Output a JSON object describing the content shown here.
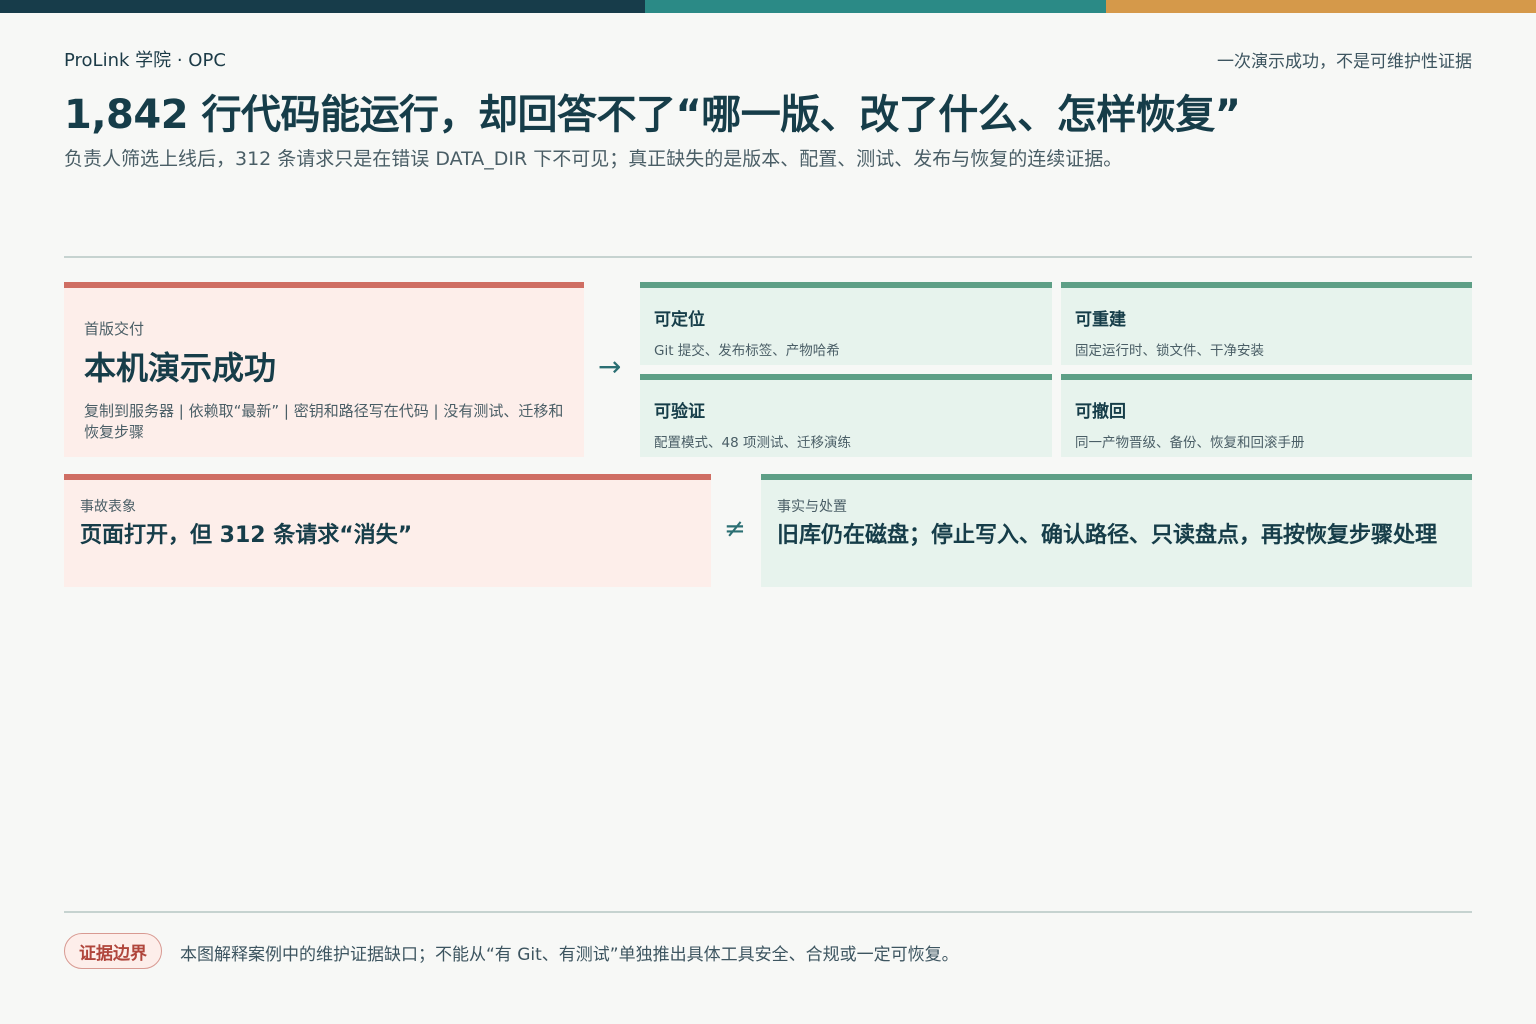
{
  "colors": {
    "bar_dark": "#173c4a",
    "bar_teal": "#2b8a86",
    "bar_orange": "#d5994a",
    "risk_red": "#cf6e63",
    "safe_green": "#5e9f86"
  },
  "header": {
    "brand": "ProLink 学院 · OPC",
    "tagline": "一次演示成功，不是可维护性证据",
    "title": "1,842 行代码能运行，却回答不了“哪一版、改了什么、怎样恢复”",
    "subtitle": "负责人筛选上线后，312 条请求只是在错误 DATA_DIR 下不可见；真正缺失的是版本、配置、测试、发布与恢复的连续证据。"
  },
  "hero": {
    "kicker": "首版交付",
    "head": "本机演示成功",
    "desc": "复制到服务器 | 依赖取“最新” | 密钥和路径写在代码 | 没有测试、迁移和恢复步骤"
  },
  "arrow_icon": "→",
  "capabilities": [
    {
      "title": "可定位",
      "desc": "Git 提交、发布标签、产物哈希"
    },
    {
      "title": "可重建",
      "desc": "固定运行时、锁文件、干净安装"
    },
    {
      "title": "可验证",
      "desc": "配置模式、48 项测试、迁移演练"
    },
    {
      "title": "可撤回",
      "desc": "同一产物晋级、备份、恢复和回滚手册"
    }
  ],
  "incident": {
    "kicker": "事故表象",
    "head": "页面打开，但 312 条请求“消失”"
  },
  "not_equal_icon": "≠",
  "facts": {
    "kicker": "事实与处置",
    "head": "旧库仍在磁盘；停止写入、确认路径、只读盘点，再按恢复步骤处理"
  },
  "footer": {
    "badge": "证据边界",
    "note": "本图解释案例中的维护证据缺口；不能从“有 Git、有测试”单独推出具体工具安全、合规或一定可恢复。"
  }
}
